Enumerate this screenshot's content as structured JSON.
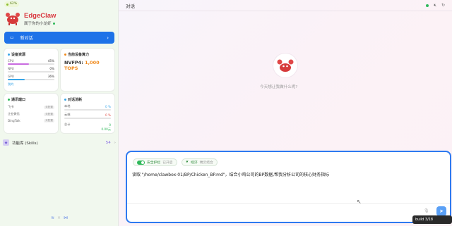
{
  "badge": {
    "text": "62%"
  },
  "brand": {
    "name": "EdgeClaw",
    "tagline": "属于你的小龙虾"
  },
  "newchat": {
    "label": "新对话"
  },
  "resources": {
    "title": "设备资源",
    "rows": [
      {
        "name": "CPU",
        "value": "45%",
        "pct": 0.45,
        "color": "#c96be0"
      },
      {
        "name": "NPU",
        "value": "0%",
        "pct": 0,
        "color": "#c96be0"
      },
      {
        "name": "GPU",
        "value": "36%",
        "pct": 0.36,
        "color": "#39a6e8"
      }
    ],
    "footer": "我的"
  },
  "compute": {
    "title": "当前设备算力",
    "label": "NVFP4:",
    "value": "1,000 TOPS"
  },
  "channels": {
    "title": "通讯端口",
    "rows": [
      {
        "name": "飞书",
        "status": "未配置"
      },
      {
        "name": "企业微信",
        "status": "未配置"
      },
      {
        "name": "DingTalk",
        "status": "未配置"
      }
    ]
  },
  "tokens": {
    "title": "对话消耗",
    "rows": [
      {
        "name": "本地",
        "value": "0 %",
        "pct": 0
      },
      {
        "name": "云端",
        "value": "0 %",
        "pct": 0
      }
    ],
    "total_label": "总计",
    "total_value": "0",
    "cost": "0.00元"
  },
  "skills": {
    "label": "功能库 (Skills)",
    "count": "54"
  },
  "topbar": {
    "title": "对话"
  },
  "empty": {
    "hint": "今天想让我做什么呢?"
  },
  "composer": {
    "pill1_label": "安全护栏",
    "pill1_state": "已开启",
    "pill2_label": "经济",
    "pill2_state": "端云结合",
    "text": "读取 \"/home/clawbox-01/BP/Chicken_BP.md\"，结合小鸡公司的BP数据,帮我分析公司的核心财务指标"
  },
  "build": {
    "text": "build 3/18 18:07:49"
  }
}
